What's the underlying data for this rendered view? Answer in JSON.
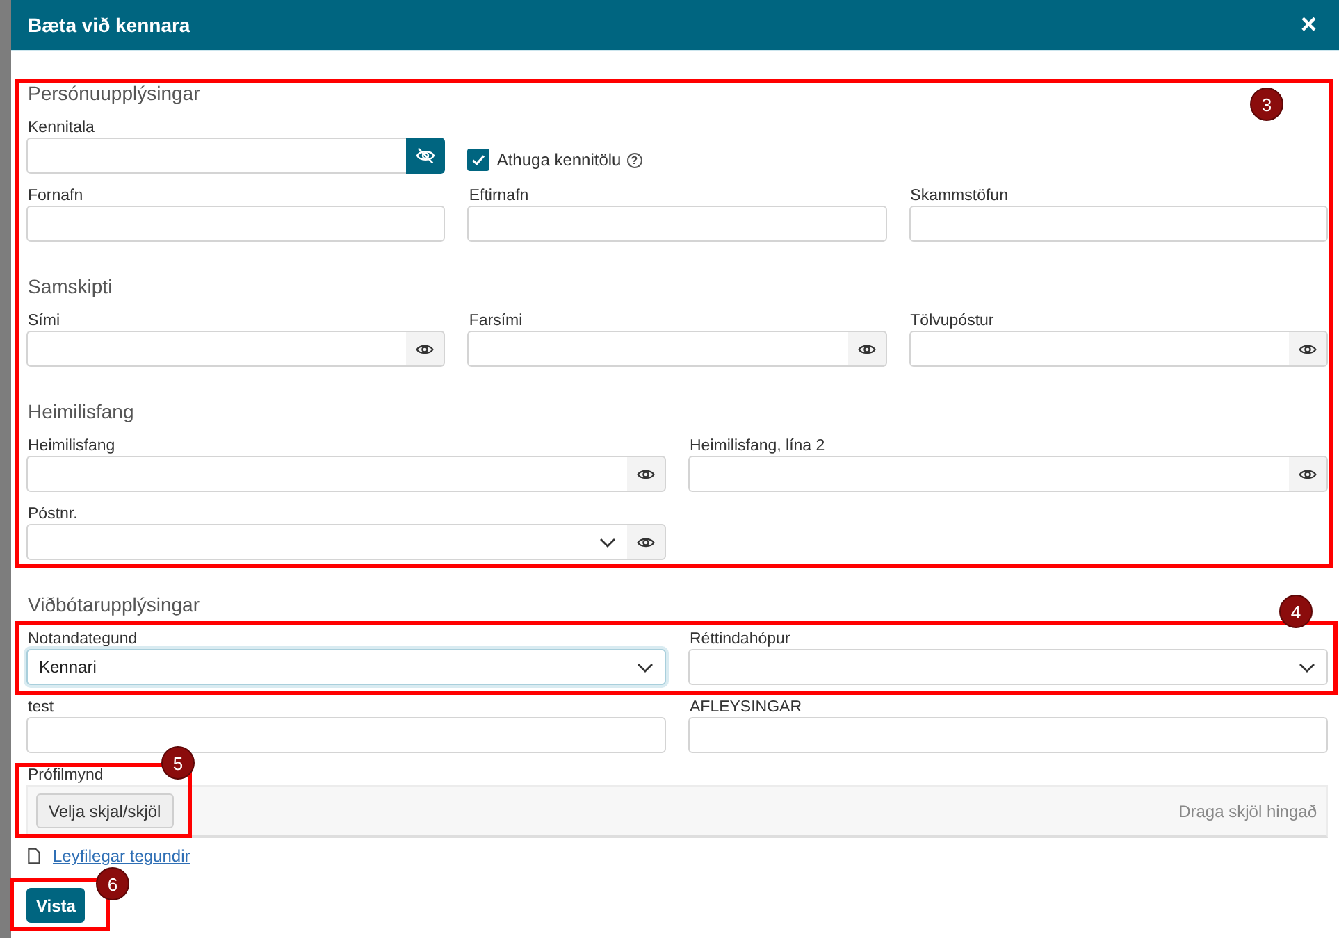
{
  "dialog": {
    "title": "Bæta við kennara",
    "close": "×"
  },
  "sections": [
    {
      "heading": "Persónuupplýsingar",
      "fields": [
        {
          "kind": "input",
          "label": "Kennitala",
          "masked": true
        },
        {
          "kind": "checkbox",
          "label": "Athuga kennitölu",
          "checked": true,
          "help_mark": "?"
        },
        {
          "kind": "input",
          "label": "Fornafn"
        },
        {
          "kind": "input",
          "label": "Eftirnafn"
        },
        {
          "kind": "input",
          "label": "Skammstöfun"
        }
      ]
    },
    {
      "heading": "Samskipti",
      "fields": [
        {
          "kind": "input",
          "label": "Sími",
          "masked": false
        },
        {
          "kind": "input",
          "label": "Farsími",
          "masked": false
        },
        {
          "kind": "input",
          "label": "Tölvupóstur",
          "masked": false
        }
      ]
    },
    {
      "heading": "Heimilisfang",
      "fields": [
        {
          "kind": "input",
          "label": "Heimilisfang",
          "masked": false
        },
        {
          "kind": "input",
          "label": "Heimilisfang, lína 2",
          "masked": false
        },
        {
          "kind": "select",
          "label": "Póstnr.",
          "masked": false
        }
      ]
    },
    {
      "heading": "Viðbótarupplýsingar",
      "fields": [
        {
          "kind": "select",
          "label": "Notandategund",
          "value": "Kennari",
          "focused": true
        },
        {
          "kind": "select",
          "label": "Réttindahópur",
          "focused": false
        },
        {
          "kind": "input",
          "label": "test"
        },
        {
          "kind": "input",
          "label": "AFLEYSINGAR"
        },
        {
          "kind": "upload",
          "label": "Prófilmynd",
          "button": "Velja skjal/skjöl",
          "hint": "Draga skjöl hingað"
        }
      ]
    }
  ],
  "allowed_types_link": "Leyfilegar tegundir",
  "save_button": "Vista",
  "annotations": [
    {
      "number": "3"
    },
    {
      "number": "4"
    },
    {
      "number": "5"
    },
    {
      "number": "6"
    }
  ]
}
